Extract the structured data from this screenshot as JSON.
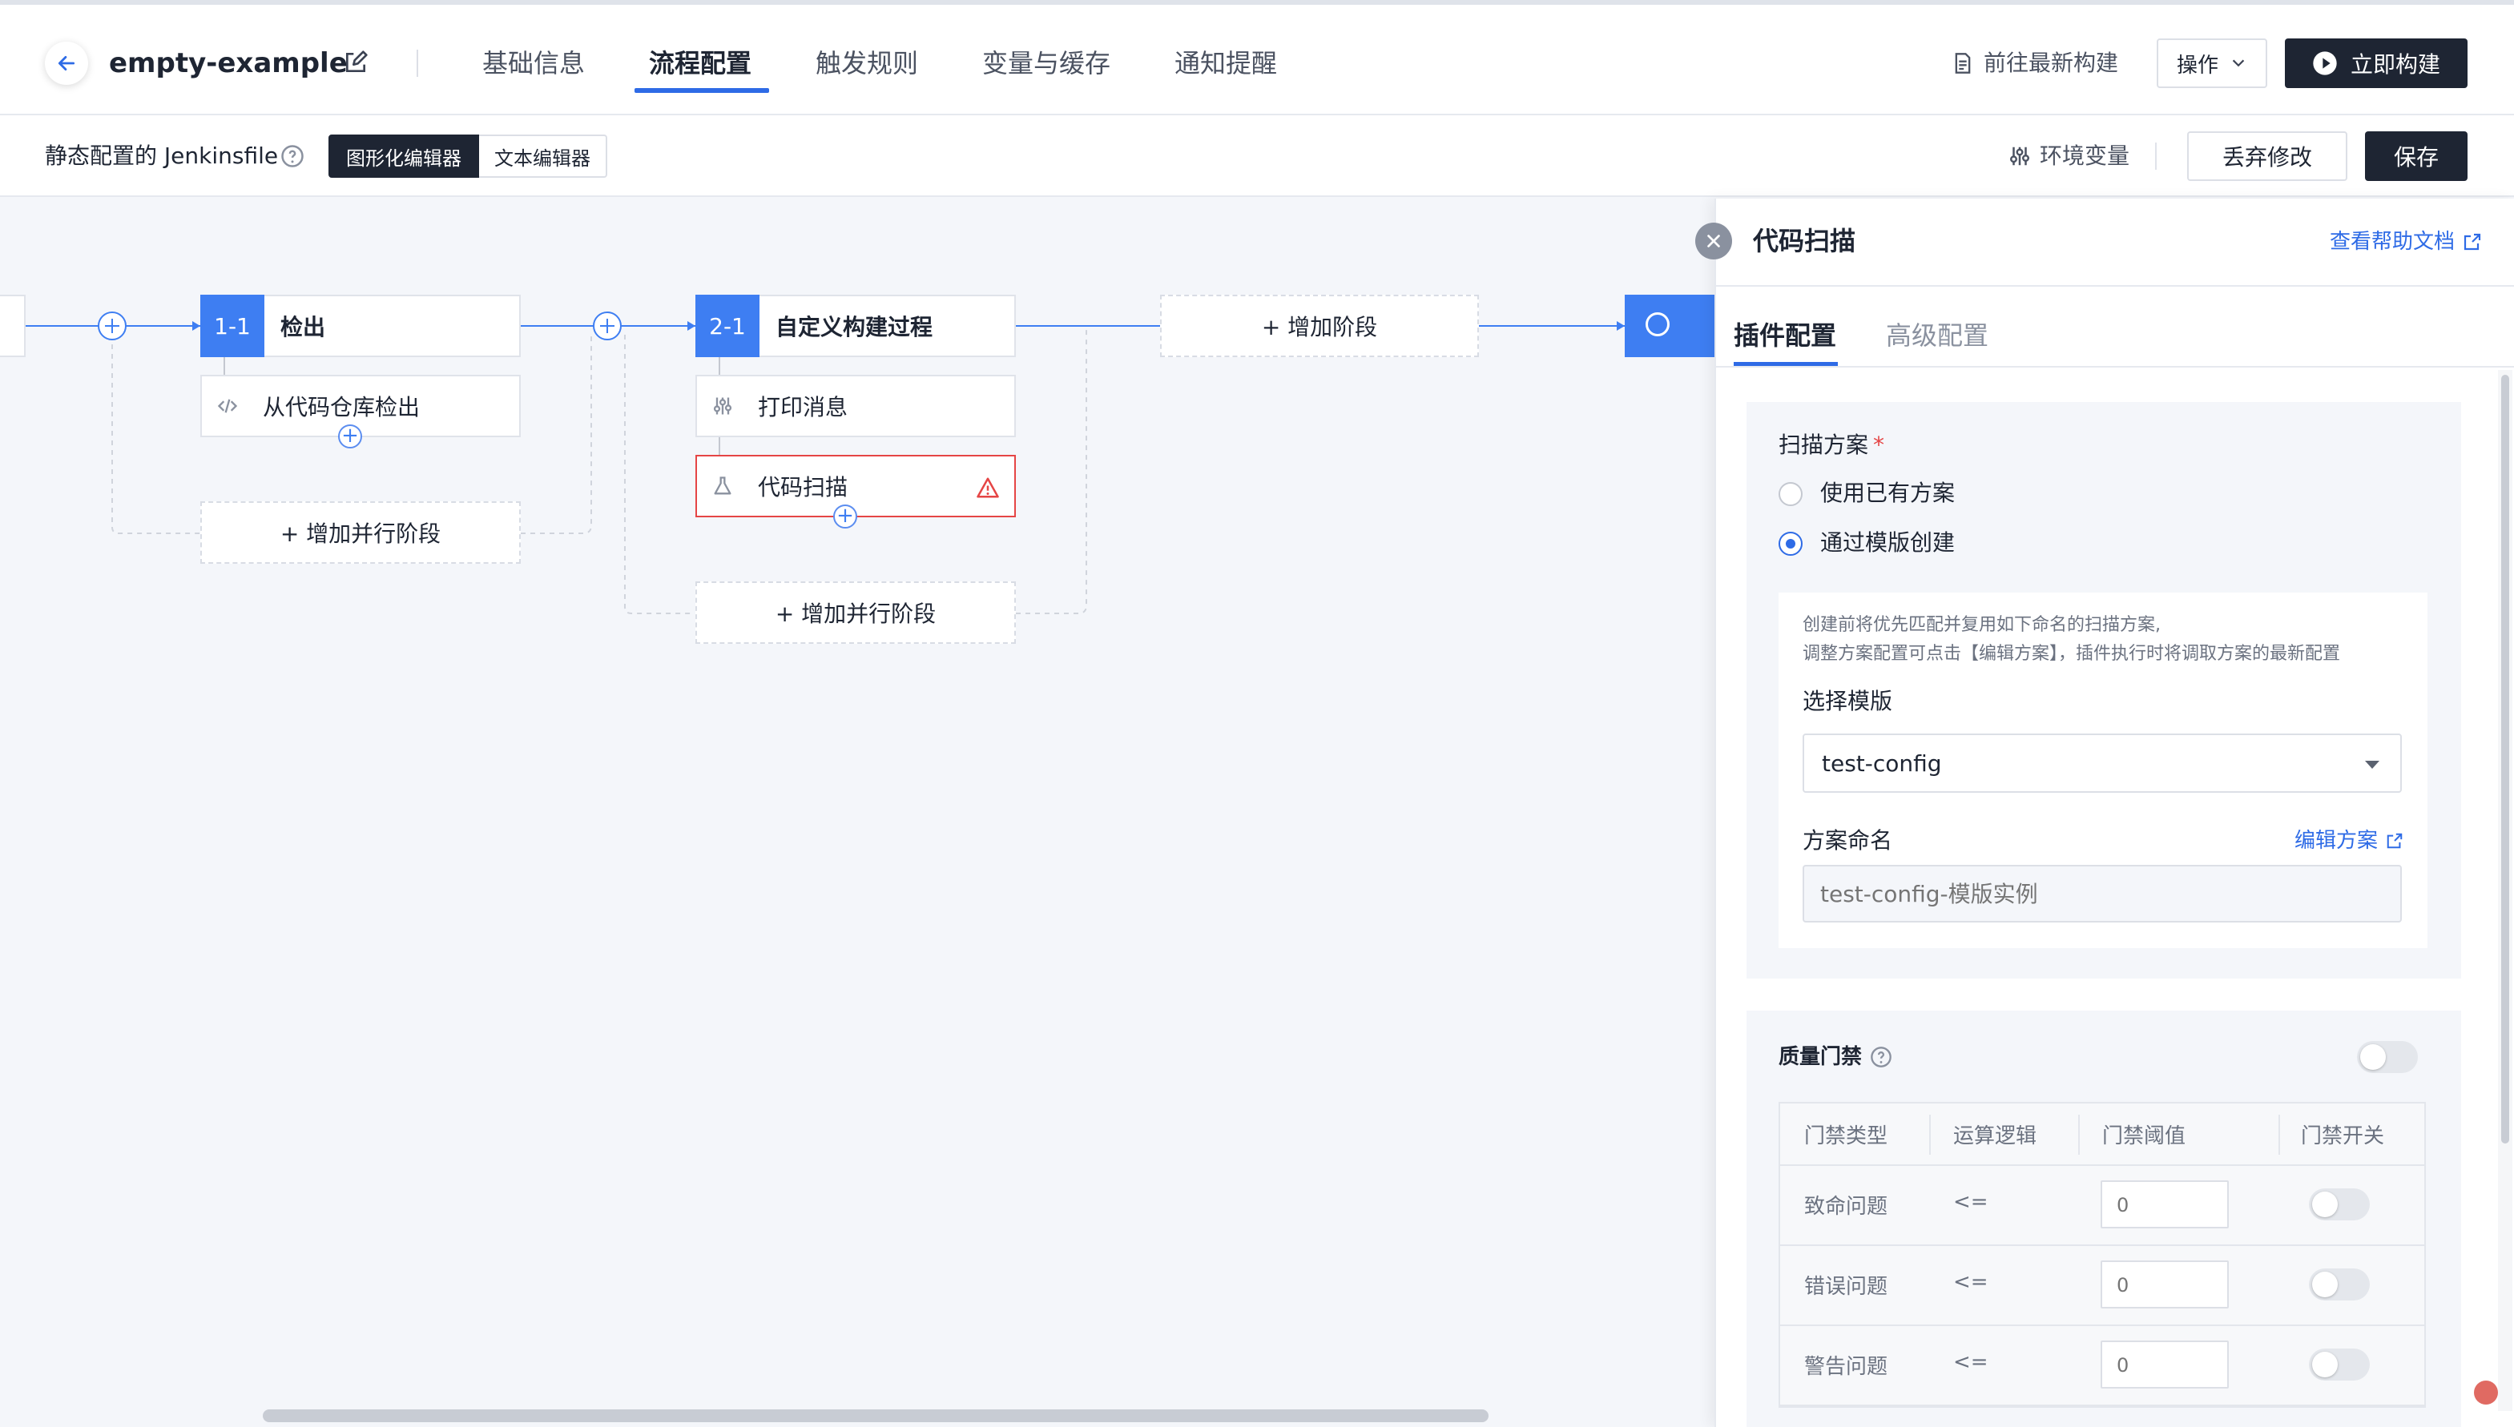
{
  "header": {
    "project_name": "empty-example",
    "tabs": [
      {
        "label": "基础信息"
      },
      {
        "label": "流程配置"
      },
      {
        "label": "触发规则"
      },
      {
        "label": "变量与缓存"
      },
      {
        "label": "通知提醒"
      }
    ],
    "active_tab": "流程配置",
    "latest_build_link": "前往最新构建",
    "ops_label": "操作",
    "build_now_label": "立即构建"
  },
  "toolbar": {
    "jenkinsfile_label": "静态配置的 Jenkinsfile",
    "editor_graphical": "图形化编辑器",
    "editor_text": "文本编辑器",
    "env_vars_label": "环境变量",
    "discard_label": "丢弃修改",
    "save_label": "保存"
  },
  "pipeline": {
    "stages": [
      {
        "number": "1-1",
        "name": "检出",
        "steps": [
          {
            "name": "从代码仓库检出",
            "icon": "code-icon"
          }
        ]
      },
      {
        "number": "2-1",
        "name": "自定义构建过程",
        "steps": [
          {
            "name": "打印消息",
            "icon": "sliders-icon"
          },
          {
            "name": "代码扫描",
            "icon": "flask-icon",
            "error": true
          }
        ]
      }
    ],
    "add_parallel_label": "+ 增加并行阶段",
    "add_stage_label": "+ 增加阶段",
    "plus_symbol": "+"
  },
  "panel": {
    "title": "代码扫描",
    "help_link": "查看帮助文档",
    "tabs": [
      {
        "label": "插件配置"
      },
      {
        "label": "高级配置"
      }
    ],
    "active_tab": "插件配置",
    "scan_scheme": {
      "label": "扫描方案",
      "required_mark": "*",
      "options": [
        {
          "label": "使用已有方案",
          "checked": false
        },
        {
          "label": "通过模版创建",
          "checked": true
        }
      ],
      "hint_line1": "创建前将优先匹配并复用如下命名的扫描方案,",
      "hint_line2": "调整方案配置可点击【编辑方案】，插件执行时将调取方案的最新配置",
      "template_label": "选择模版",
      "template_value": "test-config",
      "name_label": "方案命名",
      "edit_scheme_link": "编辑方案",
      "name_placeholder": "test-config-模版实例"
    },
    "quality_gate": {
      "title": "质量门禁",
      "enabled": false,
      "columns": [
        "门禁类型",
        "运算逻辑",
        "门禁阈值",
        "门禁开关"
      ],
      "rows": [
        {
          "type": "致命问题",
          "operator": "<=",
          "threshold_placeholder": "0",
          "enabled": false
        },
        {
          "type": "错误问题",
          "operator": "<=",
          "threshold_placeholder": "0",
          "enabled": false
        },
        {
          "type": "警告问题",
          "operator": "<=",
          "threshold_placeholder": "0",
          "enabled": false
        }
      ]
    }
  },
  "colors": {
    "accent": "#2e6be6",
    "stage_blue": "#3e7ef2",
    "dark": "#1e2533",
    "error": "#e54545"
  }
}
